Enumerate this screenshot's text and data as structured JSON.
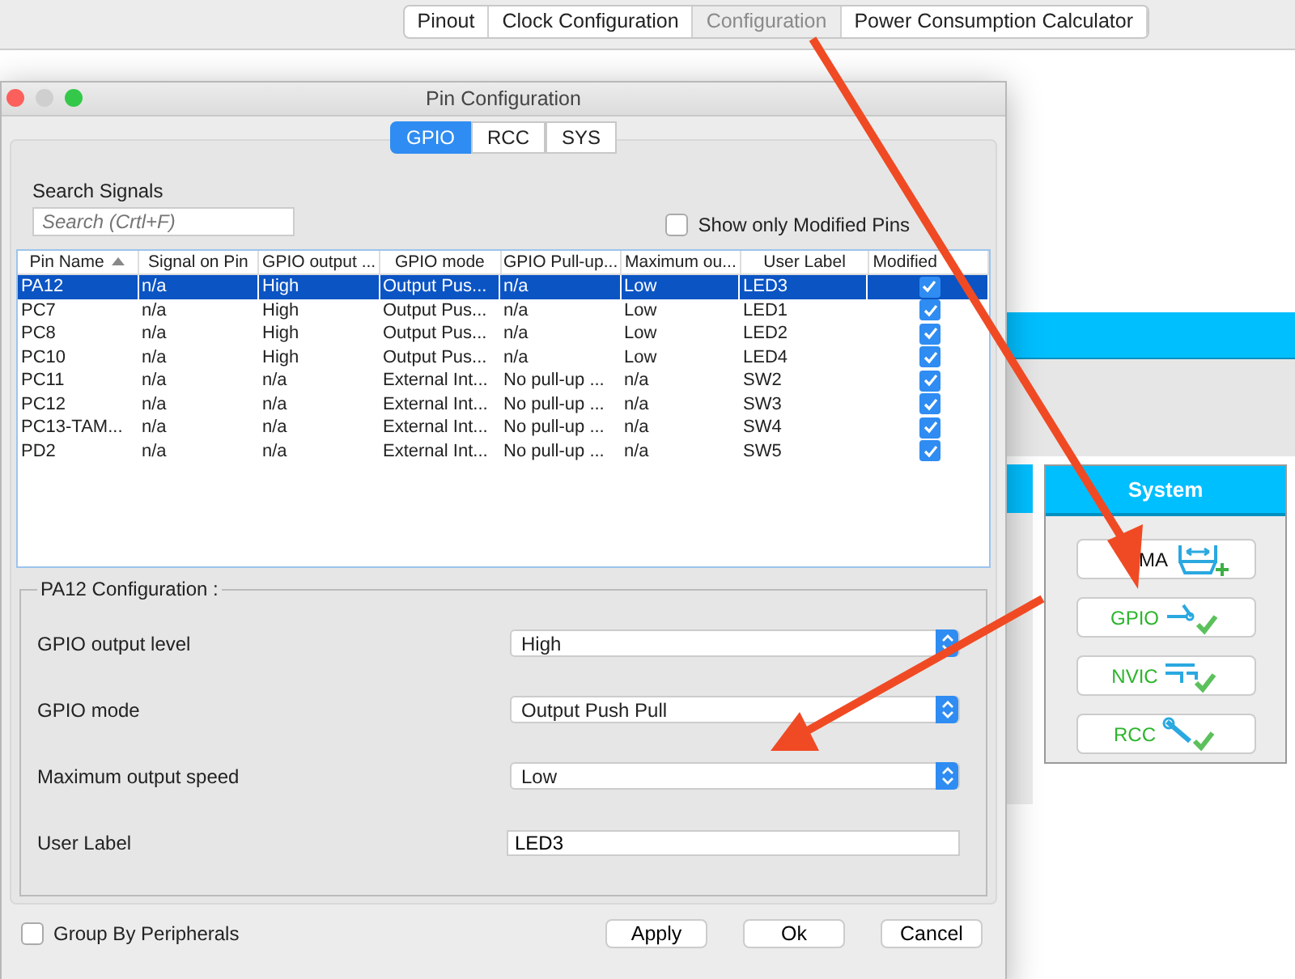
{
  "top_tabs": [
    {
      "label": "Pinout",
      "selected": false
    },
    {
      "label": "Clock Configuration",
      "selected": false
    },
    {
      "label": "Configuration",
      "selected": true
    },
    {
      "label": "Power Consumption Calculator",
      "selected": false
    }
  ],
  "dialog": {
    "title": "Pin Configuration",
    "tabs": [
      {
        "label": "GPIO",
        "selected": true
      },
      {
        "label": "RCC",
        "selected": false
      },
      {
        "label": "SYS",
        "selected": false
      }
    ],
    "search": {
      "label": "Search Signals",
      "placeholder": "Search (Crtl+F)"
    },
    "show_modified": {
      "label": "Show only Modified Pins",
      "checked": false
    },
    "table": {
      "columns": [
        {
          "label": "Pin Name",
          "sorted": true
        },
        {
          "label": "Signal on Pin",
          "sorted": false
        },
        {
          "label": "GPIO output ...",
          "sorted": false
        },
        {
          "label": "GPIO mode",
          "sorted": false
        },
        {
          "label": "GPIO Pull-up...",
          "sorted": false
        },
        {
          "label": "Maximum ou...",
          "sorted": false
        },
        {
          "label": "User Label",
          "sorted": false
        },
        {
          "label": "Modified",
          "sorted": false
        }
      ],
      "rows": [
        {
          "cells": [
            "PA12",
            "n/a",
            "High",
            "Output Pus...",
            "n/a",
            "Low",
            "LED3"
          ],
          "modified": true,
          "selected": true
        },
        {
          "cells": [
            "PC7",
            "n/a",
            "High",
            "Output Pus...",
            "n/a",
            "Low",
            "LED1"
          ],
          "modified": true,
          "selected": false
        },
        {
          "cells": [
            "PC8",
            "n/a",
            "High",
            "Output Pus...",
            "n/a",
            "Low",
            "LED2"
          ],
          "modified": true,
          "selected": false
        },
        {
          "cells": [
            "PC10",
            "n/a",
            "High",
            "Output Pus...",
            "n/a",
            "Low",
            "LED4"
          ],
          "modified": true,
          "selected": false
        },
        {
          "cells": [
            "PC11",
            "n/a",
            "n/a",
            "External Int...",
            "No pull-up ...",
            "n/a",
            "SW2"
          ],
          "modified": true,
          "selected": false
        },
        {
          "cells": [
            "PC12",
            "n/a",
            "n/a",
            "External Int...",
            "No pull-up ...",
            "n/a",
            "SW3"
          ],
          "modified": true,
          "selected": false
        },
        {
          "cells": [
            "PC13-TAM...",
            "n/a",
            "n/a",
            "External Int...",
            "No pull-up ...",
            "n/a",
            "SW4"
          ],
          "modified": true,
          "selected": false
        },
        {
          "cells": [
            "PD2",
            "n/a",
            "n/a",
            "External Int...",
            "No pull-up ...",
            "n/a",
            "SW5"
          ],
          "modified": true,
          "selected": false
        }
      ]
    },
    "config": {
      "title": "PA12 Configuration :",
      "fields": [
        {
          "kind": "select",
          "label": "GPIO output level",
          "value": "High"
        },
        {
          "kind": "select",
          "label": "GPIO mode",
          "value": "Output Push Pull"
        },
        {
          "kind": "select",
          "label": "Maximum output speed",
          "value": "Low"
        },
        {
          "kind": "text",
          "label": "User Label",
          "value": "LED3"
        }
      ]
    },
    "group_by": {
      "label": "Group By Peripherals",
      "checked": false
    },
    "buttons": [
      "Apply",
      "Ok",
      "Cancel"
    ]
  },
  "system": {
    "title": "System",
    "items": [
      {
        "label": "MA",
        "kind": "dma",
        "configured": false
      },
      {
        "label": "GPIO",
        "kind": "gpio",
        "configured": true
      },
      {
        "label": "NVIC",
        "kind": "nvic",
        "configured": true
      },
      {
        "label": "RCC",
        "kind": "rcc",
        "configured": true
      }
    ]
  }
}
